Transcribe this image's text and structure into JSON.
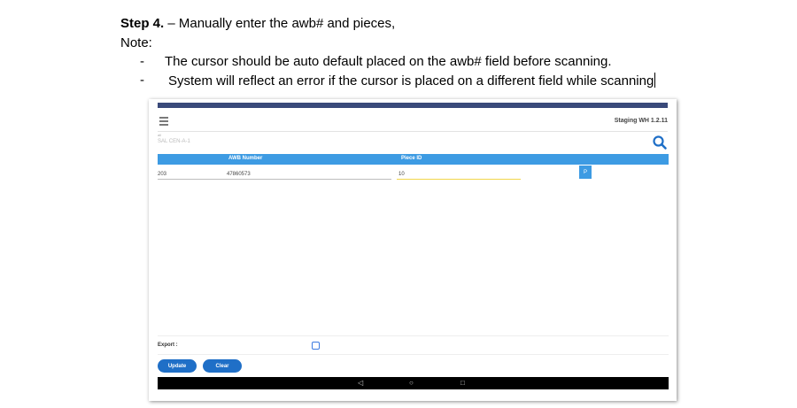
{
  "instructions": {
    "step_label": "Step 4.",
    "step_text": " – Manually enter the awb# and pieces,",
    "note_label": "Note:",
    "bullets": [
      {
        "dash": "-",
        "text": "The cursor should be auto default placed on the awb# field before scanning."
      },
      {
        "dash": "-",
        "text": "System will reflect an error if the cursor is placed on a different field while scanning"
      }
    ]
  },
  "app": {
    "version": "Staging WH 1.2.11",
    "sub_label": "all",
    "location": "SAL CEN-A-1",
    "table": {
      "headers": [
        "AWB Number",
        "Piece ID"
      ],
      "row": {
        "prefix": "203",
        "awb_number": "47860573",
        "piece_id": "10",
        "action": "P"
      }
    },
    "export_label": "Export :",
    "buttons": {
      "update": "Update",
      "clear": "Clear"
    },
    "nav": {
      "back": "◁",
      "home": "○",
      "recent": "□"
    },
    "colors": {
      "accent": "#3d9be3",
      "button": "#1f6fc7",
      "active_underline": "#f2d64b"
    },
    "icons": [
      "hamburger-menu-icon",
      "search-icon",
      "nav-back-icon",
      "nav-home-icon",
      "nav-recent-icon"
    ]
  }
}
